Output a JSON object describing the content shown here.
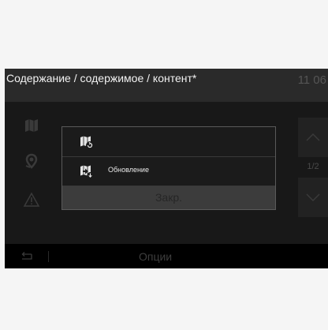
{
  "header": {
    "title": "Содержание / содержимое / контент*",
    "clock": "11 06"
  },
  "side_menu": [
    {
      "icon": "map-book-icon"
    },
    {
      "icon": "location-pin-icon"
    },
    {
      "icon": "warning-icon"
    }
  ],
  "pager": {
    "up_icon": "chevron-up-icon",
    "indicator": "1/2",
    "down_icon": "chevron-down-icon"
  },
  "footer": {
    "back_icon": "back-arrow-icon",
    "options_label": "Опции"
  },
  "dialog": {
    "rows": [
      {
        "icon": "map-refresh-icon",
        "label": ""
      },
      {
        "icon": "map-update-icon",
        "label": "Обновление"
      }
    ],
    "close_label": "Закр."
  },
  "colors": {
    "background": "#000000",
    "title_bar": "#2a2a2a",
    "content": "#181818",
    "dialog_border": "#5a5a5a",
    "close_button": "#3c3c3c"
  }
}
